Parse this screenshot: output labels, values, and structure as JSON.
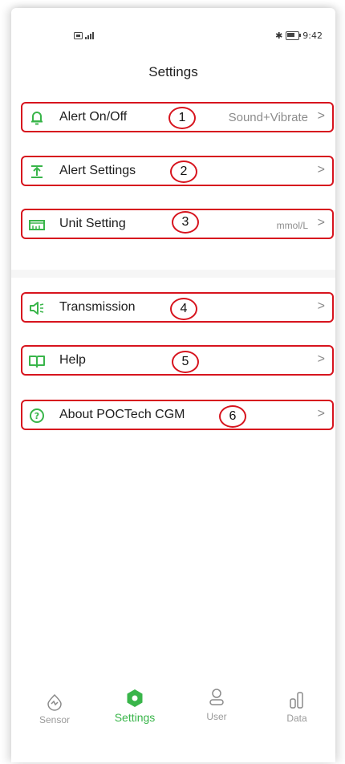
{
  "status_bar": {
    "time": "9:42"
  },
  "page": {
    "title": "Settings"
  },
  "groups": [
    [
      {
        "label": "Alert On/Off",
        "value": "Sound+Vibrate",
        "badge": "1",
        "icon": "bell-icon"
      },
      {
        "label": "Alert Settings",
        "value": "",
        "badge": "2",
        "icon": "alert-settings-icon"
      },
      {
        "label": "Unit Setting",
        "value": "mmol/L",
        "badge": "3",
        "icon": "ruler-icon"
      }
    ],
    [
      {
        "label": "Transmission",
        "value": "",
        "badge": "4",
        "icon": "speaker-icon"
      },
      {
        "label": "Help",
        "value": "",
        "badge": "5",
        "icon": "book-icon"
      },
      {
        "label": "About POCTech CGM",
        "value": "",
        "badge": "6",
        "icon": "question-circle-icon"
      }
    ]
  ],
  "chevron": ">",
  "tabbar": {
    "items": [
      {
        "label": "Sensor",
        "icon": "sensor-icon",
        "active": false
      },
      {
        "label": "Settings",
        "icon": "settings-icon",
        "active": true
      },
      {
        "label": "User",
        "icon": "user-icon",
        "active": false
      },
      {
        "label": "Data",
        "icon": "data-icon",
        "active": false
      }
    ]
  },
  "colors": {
    "accent": "#39b54a",
    "annotation": "#d7141e",
    "muted": "#9a9a9a"
  }
}
